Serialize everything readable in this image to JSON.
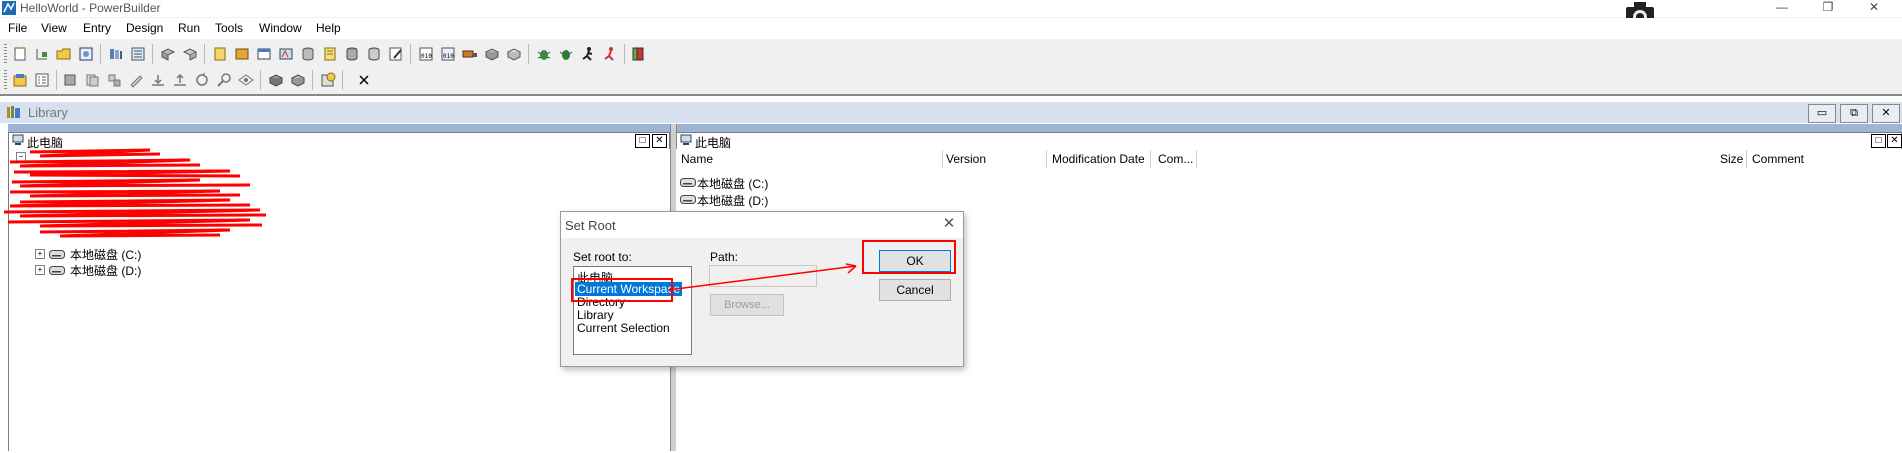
{
  "window": {
    "title": "HelloWorld - PowerBuilder",
    "controls": {
      "minimize": "—",
      "restore": "❐",
      "close": "✕"
    }
  },
  "menu": [
    "File",
    "View",
    "Entry",
    "Design",
    "Run",
    "Tools",
    "Window",
    "Help"
  ],
  "library": {
    "title": "Library",
    "left_pane": {
      "header": "此电脑",
      "tree_items": [
        "本地磁盘 (C:)",
        "本地磁盘 (D:)"
      ]
    },
    "right_pane": {
      "header": "此电脑",
      "columns": [
        "Name",
        "Version",
        "Modification Date",
        "Com...",
        "Size",
        "Comment"
      ],
      "items": [
        "本地磁盘 (C:)",
        "本地磁盘 (D:)"
      ]
    },
    "close_glyph": "✕"
  },
  "dialog": {
    "title": "Set Root",
    "set_root_label": "Set root to:",
    "path_label": "Path:",
    "root_options": [
      "此电脑",
      "Current Workspace",
      "Directory",
      "Library",
      "Current Selection"
    ],
    "selected_option": "Current Workspace",
    "browse_label": "Browse...",
    "ok_label": "OK",
    "cancel_label": "Cancel",
    "close_glyph": "✕"
  },
  "colors": {
    "selection": "#0078d7",
    "annotation": "#ff0000",
    "mdi_title": "#d6e0ee"
  }
}
